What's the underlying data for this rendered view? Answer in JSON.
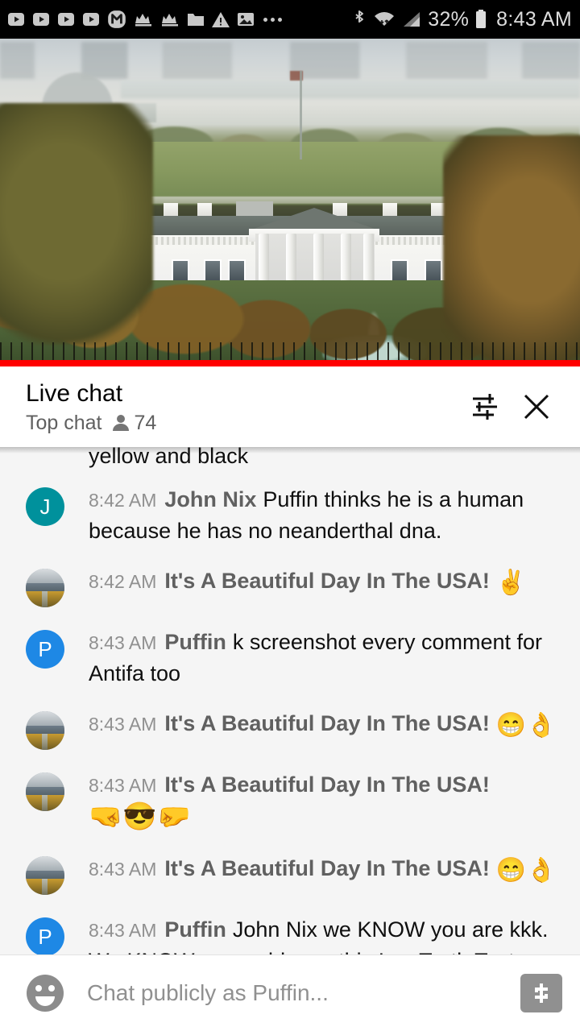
{
  "status_bar": {
    "icons": [
      "video-icon",
      "video-icon",
      "video-icon",
      "video-icon",
      "m-app-icon",
      "crown-icon",
      "crown-icon",
      "folder-icon",
      "warning-icon",
      "image-icon",
      "more-dots-icon",
      "bluetooth-icon",
      "wifi-icon",
      "cell-signal-icon"
    ],
    "battery_percent": "32%",
    "time": "8:43 AM"
  },
  "video": {
    "description": "White House north lawn live stream",
    "progress_color": "#ff0000"
  },
  "chat_header": {
    "title": "Live chat",
    "mode": "Top chat",
    "viewer_count": "74",
    "settings_icon": "sliders-icon",
    "close_icon": "close-icon"
  },
  "chat": {
    "clipped_previous_line": "yellow and black",
    "messages": [
      {
        "timestamp": "8:42 AM",
        "author": "John Nix",
        "text": "Puffin thinks he is a human because he has no neanderthal dna.",
        "avatar_type": "letter",
        "avatar_letter": "J",
        "avatar_color": "#00919c",
        "emojis": ""
      },
      {
        "timestamp": "8:42 AM",
        "author": "It's A Beautiful Day In The USA!",
        "text": "",
        "avatar_type": "photo",
        "avatar_letter": "",
        "avatar_color": "",
        "emojis": "✌"
      },
      {
        "timestamp": "8:43 AM",
        "author": "Puffin",
        "text": "k screenshot every comment for Antifa too",
        "avatar_type": "letter",
        "avatar_letter": "P",
        "avatar_color": "#1e88e5",
        "emojis": ""
      },
      {
        "timestamp": "8:43 AM",
        "author": "It's A Beautiful Day In The USA!",
        "text": "",
        "avatar_type": "photo",
        "avatar_letter": "",
        "avatar_color": "",
        "emojis": "😁👌"
      },
      {
        "timestamp": "8:43 AM",
        "author": "It's A Beautiful Day In The USA!",
        "text": "",
        "avatar_type": "photo",
        "avatar_letter": "",
        "avatar_color": "",
        "emojis": "🤜😎🤛"
      },
      {
        "timestamp": "8:43 AM",
        "author": "It's A Beautiful Day In The USA!",
        "text": "",
        "avatar_type": "photo",
        "avatar_letter": "",
        "avatar_color": "",
        "emojis": "😁👌"
      },
      {
        "timestamp": "8:43 AM",
        "author": "Puffin",
        "text": "John Nix we KNOW you are kkk. We KNOW your address. this Is a Truth Test",
        "avatar_type": "letter",
        "avatar_letter": "P",
        "avatar_color": "#1e88e5",
        "emojis": ""
      }
    ]
  },
  "input_bar": {
    "emoji_icon": "smiley-face-icon",
    "placeholder": "Chat publicly as Puffin...",
    "superchat_icon": "dollar-sign-icon"
  }
}
